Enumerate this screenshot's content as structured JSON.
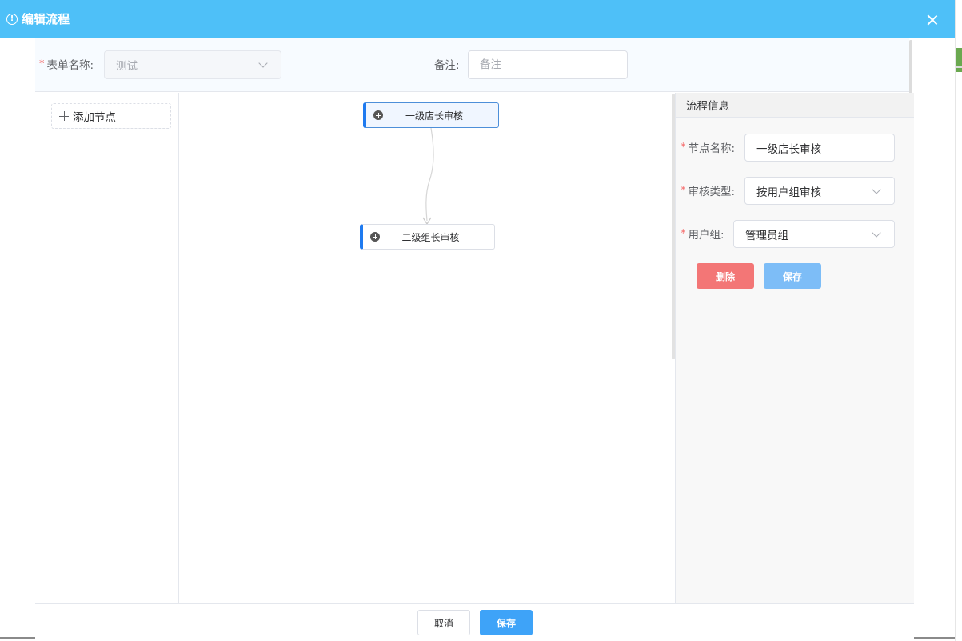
{
  "dialog": {
    "title": "编辑流程"
  },
  "form": {
    "name_label": "表单名称:",
    "name_value": "测试",
    "remark_label": "备注:",
    "remark_placeholder": "备注"
  },
  "toolbar": {
    "add_node_label": "添加节点"
  },
  "flow": {
    "nodes": [
      {
        "label": "一级店长审核"
      },
      {
        "label": "二级组长审核"
      }
    ]
  },
  "panel": {
    "title": "流程信息",
    "node_name_label": "节点名称:",
    "node_name_value": "一级店长审核",
    "review_type_label": "审核类型:",
    "review_type_value": "按用户组审核",
    "user_group_label": "用户组:",
    "user_group_value": "管理员组",
    "delete_label": "删除",
    "save_label": "保存"
  },
  "footer": {
    "cancel_label": "取消",
    "save_label": "保存"
  },
  "colors": {
    "header": "#4ec0f8",
    "node_accent": "#1e7af0",
    "delete": "#f37676",
    "primary": "#3ea3f8"
  }
}
